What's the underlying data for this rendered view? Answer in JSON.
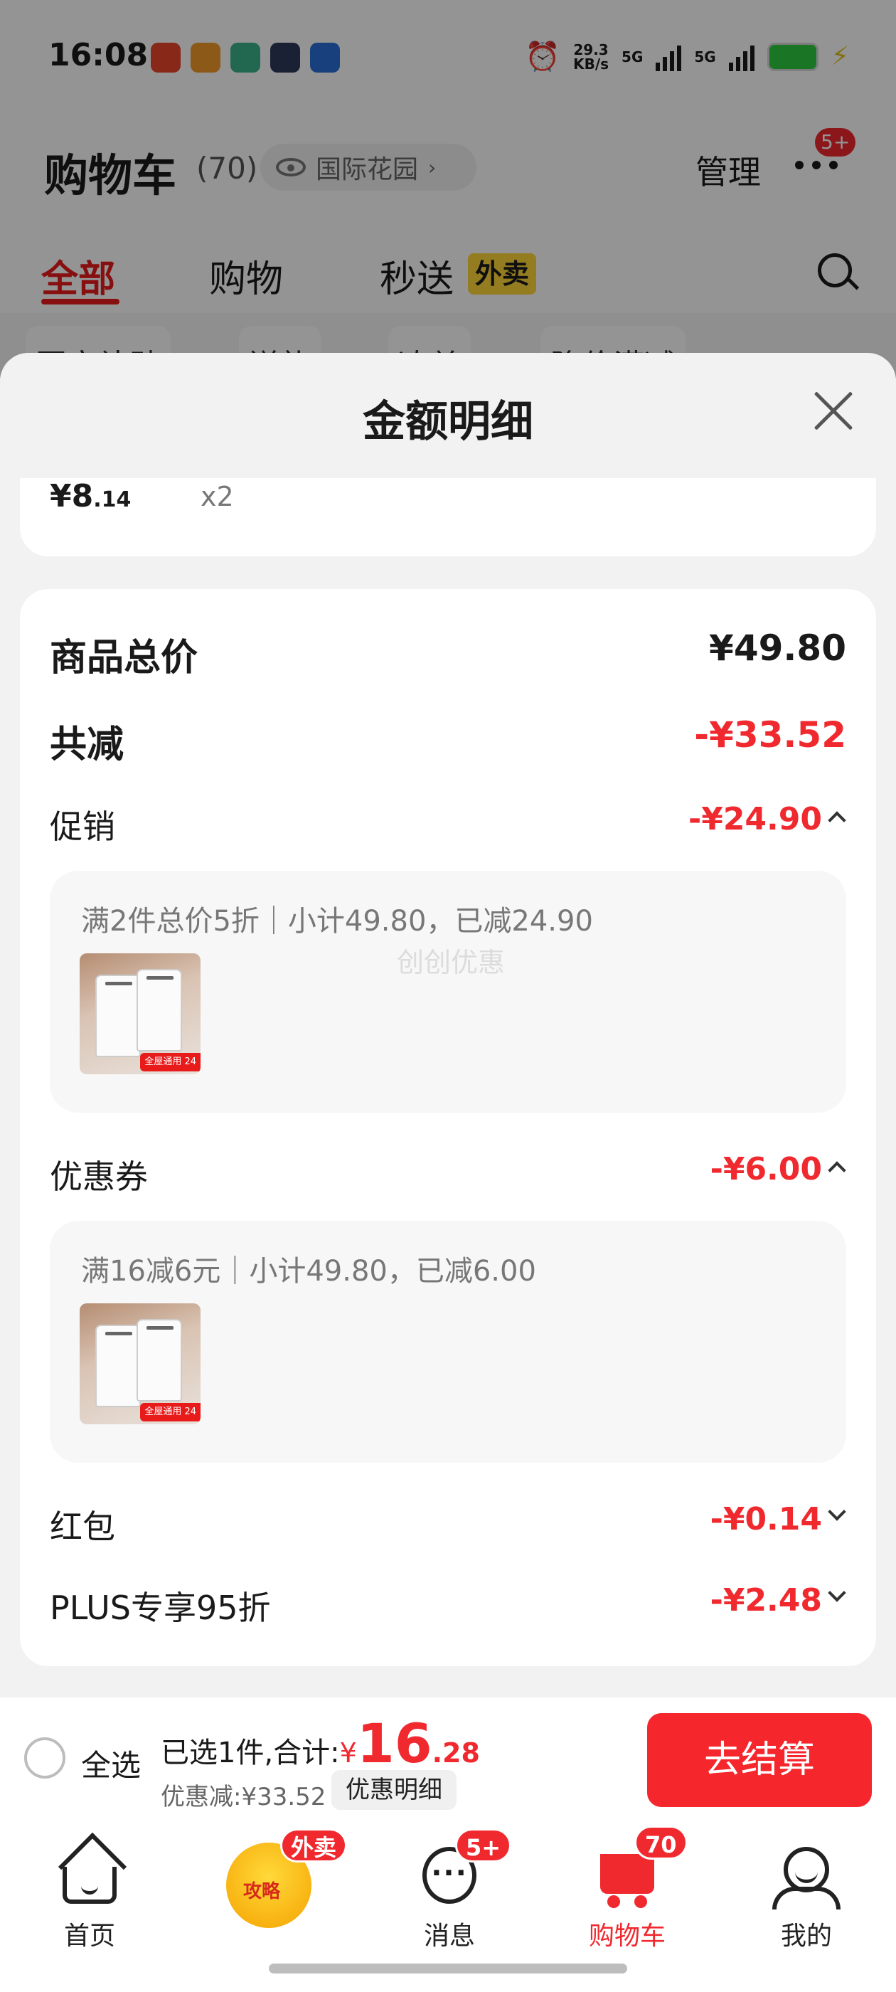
{
  "status_bar": {
    "time": "16:08",
    "network_speed": "29.3",
    "network_speed_unit": "KB/s",
    "signal1": "5G",
    "signal2": "5G"
  },
  "cart_header": {
    "title": "购物车",
    "count": "(70)",
    "location": "国际花园",
    "manage": "管理",
    "more_badge": "5+"
  },
  "tabs": {
    "all": "全部",
    "shopping": "购物",
    "fast": "秒送",
    "takeout_tag": "外卖"
  },
  "filter_chips": [
    "国家补贴",
    "送礼",
    "凑单",
    "降价满减"
  ],
  "sheet": {
    "title": "金额明细",
    "top_item": {
      "price_int": "¥8",
      "price_dec": ".14",
      "qty": "x2"
    },
    "goods_total_label": "商品总价",
    "goods_total_value": "¥49.80",
    "total_reduction_label": "共减",
    "total_reduction_value": "-¥33.52",
    "promo": {
      "label": "促销",
      "value": "-¥24.90",
      "detail": "满2件总价5折｜小计49.80，已减24.90",
      "watermark": "创创优惠",
      "thumb_tag": "全屋通用 24"
    },
    "coupon": {
      "label": "优惠券",
      "value": "-¥6.00",
      "detail": "满16减6元｜小计49.80，已减6.00",
      "thumb_tag": "全屋通用 24"
    },
    "redpacket": {
      "label": "红包",
      "value": "-¥0.14"
    },
    "plus": {
      "label": "PLUS专享95折",
      "value": "-¥2.48"
    }
  },
  "checkout": {
    "select_all": "全选",
    "selected_prefix": "已选1件,合计:",
    "yen": "¥",
    "amount_int": "16",
    "amount_dec": ".28",
    "discount": "优惠减:¥33.52",
    "detail_button": "优惠明细",
    "pay_button": "去结算"
  },
  "tabbar": {
    "home": "首页",
    "guide": "攻略",
    "guide_badge": "外卖",
    "messages": "消息",
    "messages_badge": "5+",
    "cart": "购物车",
    "cart_badge": "70",
    "me": "我的"
  },
  "colors": {
    "accent_red": "#f0292f",
    "takeout_yellow": "#ffd83a"
  }
}
